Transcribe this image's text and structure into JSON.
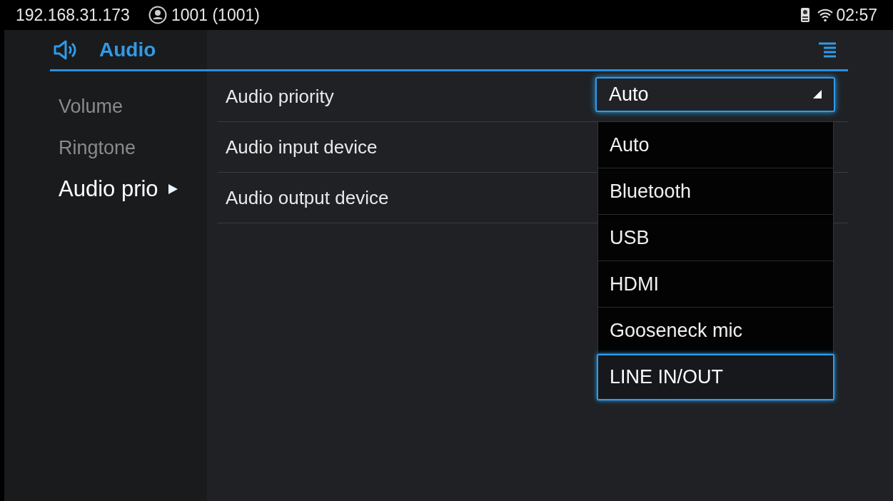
{
  "status_bar": {
    "ip": "192.168.31.173",
    "account": "1001 (1001)",
    "time": "02:57"
  },
  "header": {
    "title": "Audio"
  },
  "sidebar": {
    "items": [
      {
        "label": "Volume",
        "selected": false
      },
      {
        "label": "Ringtone",
        "selected": false
      },
      {
        "label": "Audio prio",
        "selected": true
      }
    ]
  },
  "settings": [
    {
      "label": "Audio priority",
      "kind": "dropdown",
      "value": "Auto"
    },
    {
      "label": "Audio input device",
      "kind": "plain"
    },
    {
      "label": "Audio output device",
      "kind": "plain"
    }
  ],
  "dropdown_menu": {
    "options": [
      {
        "label": "Auto",
        "selected": false
      },
      {
        "label": "Bluetooth",
        "selected": false
      },
      {
        "label": "USB",
        "selected": false
      },
      {
        "label": "HDMI",
        "selected": false
      },
      {
        "label": "Gooseneck mic",
        "selected": false
      },
      {
        "label": "LINE IN/OUT",
        "selected": true
      }
    ]
  }
}
